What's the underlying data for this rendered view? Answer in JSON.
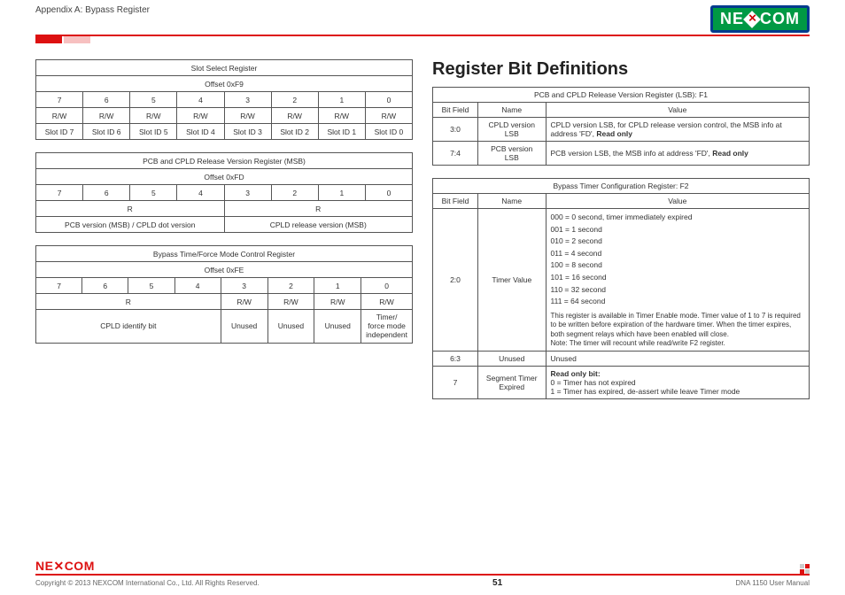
{
  "header": {
    "appendix": "Appendix A: Bypass Register",
    "logo_left": "NE",
    "logo_right": "COM"
  },
  "left": {
    "t1": {
      "title": "Slot Select Register",
      "offset": "Offset 0xF9",
      "bits": [
        "7",
        "6",
        "5",
        "4",
        "3",
        "2",
        "1",
        "0"
      ],
      "rw": [
        "R/W",
        "R/W",
        "R/W",
        "R/W",
        "R/W",
        "R/W",
        "R/W",
        "R/W"
      ],
      "names": [
        "Slot ID 7",
        "Slot ID 6",
        "Slot ID 5",
        "Slot ID 4",
        "Slot ID 3",
        "Slot ID 2",
        "Slot ID 1",
        "Slot ID 0"
      ]
    },
    "t2": {
      "title": "PCB and CPLD Release Version Register (MSB)",
      "offset": "Offset 0xFD",
      "bits": [
        "7",
        "6",
        "5",
        "4",
        "3",
        "2",
        "1",
        "0"
      ],
      "r_left": "R",
      "r_right": "R",
      "desc_left": "PCB version (MSB) / CPLD dot version",
      "desc_right": "CPLD release version (MSB)"
    },
    "t3": {
      "title": "Bypass Time/Force Mode Control Register",
      "offset": "Offset 0xFE",
      "bits": [
        "7",
        "6",
        "5",
        "4",
        "3",
        "2",
        "1",
        "0"
      ],
      "r_left": "R",
      "rw": [
        "R/W",
        "R/W",
        "R/W",
        "R/W"
      ],
      "desc_left": "CPLD identify bit",
      "unused": "Unused",
      "timer": "Timer/\nforce mode\nindependent"
    }
  },
  "right": {
    "heading": "Register Bit Definitions",
    "t1": {
      "title": "PCB and CPLD Release Version Register (LSB): F1",
      "h_bit": "Bit Field",
      "h_name": "Name",
      "h_val": "Value",
      "r1_bit": "3:0",
      "r1_name": "CPLD version LSB",
      "r1_val_a": "CPLD version LSB, for CPLD release version control, the MSB info at address 'FD', ",
      "r1_val_b": "Read only",
      "r2_bit": "7:4",
      "r2_name": "PCB version LSB",
      "r2_val_a": "PCB version LSB, the MSB info at address 'FD', ",
      "r2_val_b": "Read only"
    },
    "t2": {
      "title": "Bypass Timer Configuration Register: F2",
      "h_bit": "Bit Field",
      "h_name": "Name",
      "h_val": "Value",
      "r1_bit": "2:0",
      "r1_name": "Timer Value",
      "timer_lines": [
        "000 = 0 second, timer immediately expired",
        "001 = 1 second",
        "010 = 2 second",
        "011 = 4 second",
        "100 = 8 second",
        "101 = 16 second",
        "110 = 32 second",
        "111 = 64 second"
      ],
      "timer_note": "This register is available in Timer Enable mode. Timer value of 1 to 7 is required to be written before expiration of the hardware timer. When the timer expires, both segment relays which have been enabled will close.\nNote: The timer will recount while read/write F2 register.",
      "r2_bit": "6:3",
      "r2_name": "Unused",
      "r2_val": "Unused",
      "r3_bit": "7",
      "r3_name": "Segment Timer Expired",
      "r3_head": "Read only bit:",
      "r3_l1": "0 = Timer has not expired",
      "r3_l2": "1 = Timer has expired, de-assert while leave Timer mode"
    }
  },
  "footer": {
    "logo_left": "NE",
    "logo_right": "COM",
    "copyright": "Copyright © 2013 NEXCOM International Co., Ltd. All Rights Reserved.",
    "page": "51",
    "manual": "DNA 1150 User Manual"
  }
}
